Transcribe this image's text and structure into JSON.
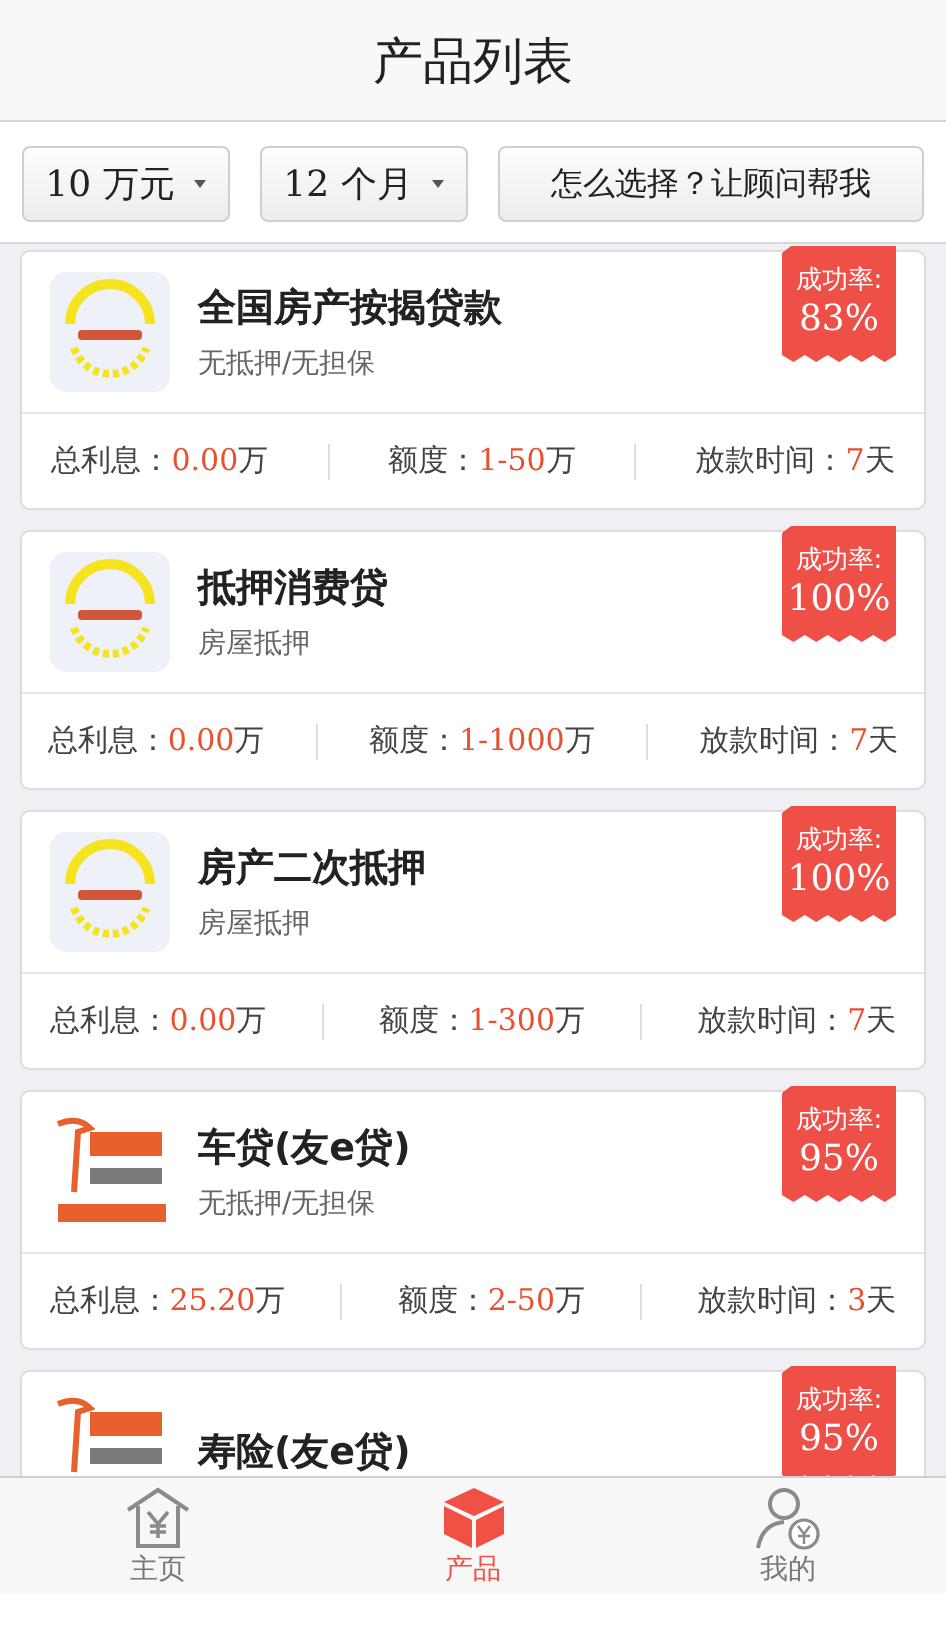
{
  "header": {
    "title": "产品列表"
  },
  "filters": [
    {
      "kind": "dropdown",
      "label": "10 万元"
    },
    {
      "kind": "dropdown",
      "label": "12 个月"
    },
    {
      "kind": "button",
      "label": "怎么选择？让顾问帮我"
    }
  ],
  "products": [
    {
      "kind": "wheat",
      "name": "全国房产按揭贷款",
      "subtitle": "无抵押/无担保",
      "badge_label": "成功率:",
      "badge_value": "83%",
      "stats": [
        {
          "label": "总利息：",
          "value": "0.00",
          "unit": "万"
        },
        {
          "label": "额度：",
          "value": "1-50",
          "unit": "万"
        },
        {
          "label": "放款时间：",
          "value": "7",
          "unit": "天"
        }
      ]
    },
    {
      "kind": "wheat",
      "name": "抵押消费贷",
      "subtitle": "房屋抵押",
      "badge_label": "成功率:",
      "badge_value": "100%",
      "stats": [
        {
          "label": "总利息：",
          "value": "0.00",
          "unit": "万"
        },
        {
          "label": "额度：",
          "value": "1-1000",
          "unit": "万"
        },
        {
          "label": "放款时间：",
          "value": "7",
          "unit": "天"
        }
      ]
    },
    {
      "kind": "wheat",
      "name": "房产二次抵押",
      "subtitle": "房屋抵押",
      "badge_label": "成功率:",
      "badge_value": "100%",
      "stats": [
        {
          "label": "总利息：",
          "value": "0.00",
          "unit": "万"
        },
        {
          "label": "额度：",
          "value": "1-300",
          "unit": "万"
        },
        {
          "label": "放款时间：",
          "value": "7",
          "unit": "天"
        }
      ]
    },
    {
      "kind": "city",
      "name": "车贷(友e贷)",
      "subtitle": "无抵押/无担保",
      "badge_label": "成功率:",
      "badge_value": "95%",
      "stats": [
        {
          "label": "总利息：",
          "value": "25.20",
          "unit": "万"
        },
        {
          "label": "额度：",
          "value": "2-50",
          "unit": "万"
        },
        {
          "label": "放款时间：",
          "value": "3",
          "unit": "天"
        }
      ]
    },
    {
      "kind": "city",
      "name": "寿险(友e贷)",
      "badge_label": "成功率:",
      "badge_value": "95%"
    }
  ],
  "tabs": [
    {
      "kind": "home",
      "label": "主页",
      "selected": false
    },
    {
      "kind": "box",
      "label": "产品",
      "selected": true
    },
    {
      "kind": "user",
      "label": "我的",
      "selected": false
    }
  ]
}
